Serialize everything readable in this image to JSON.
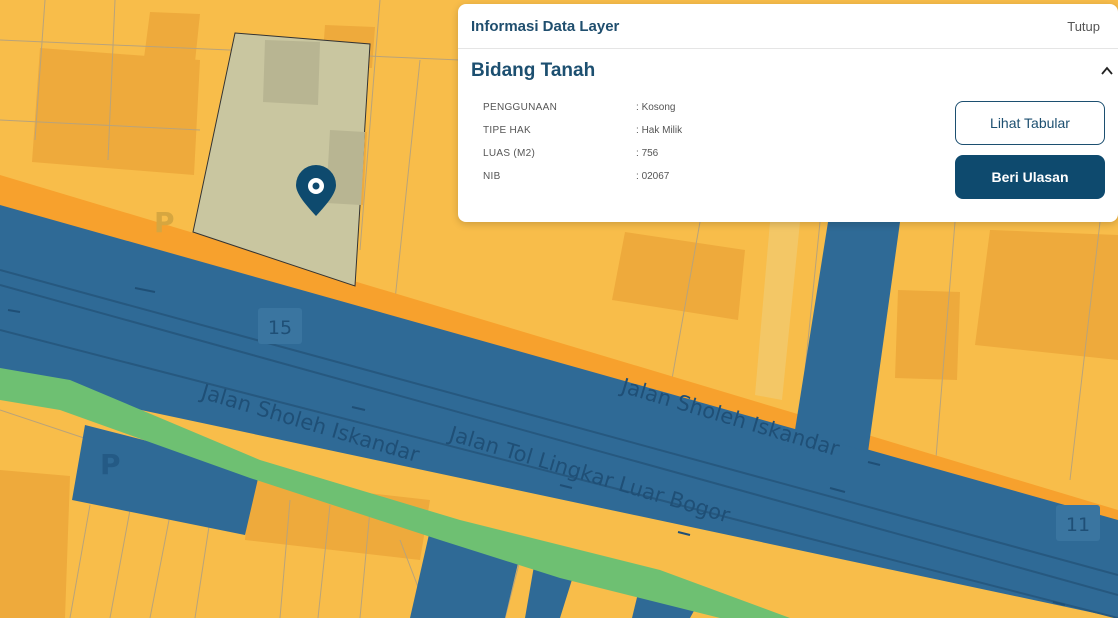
{
  "panel": {
    "title": "Informasi Data Layer",
    "close_label": "Tutup",
    "section_title": "Bidang Tanah",
    "attributes": [
      {
        "label": "PENGGUNAAN",
        "value": "Kosong"
      },
      {
        "label": "TIPE HAK",
        "value": "Hak Milik"
      },
      {
        "label": "LUAS (M2)",
        "value": "756"
      },
      {
        "label": "NIB",
        "value": "02067"
      }
    ],
    "tabular_button": "Lihat Tabular",
    "review_button": "Beri Ulasan"
  },
  "map": {
    "road_labels": [
      "Jalan Sholeh Iskandar",
      "Jalan Sholeh Iskandar",
      "Jalan Tol Lingkar Luar Bogor"
    ],
    "route_numbers": [
      "15",
      "11"
    ],
    "parking_symbol": "P",
    "colors": {
      "parcel": "#f8bd4a",
      "building": "#eeaa3c",
      "road_orange": "#f7a12d",
      "toll_road": "#2f6a96",
      "green_strip": "#6ec072",
      "selected_parcel": "#c9c6a0",
      "marker": "#0e4a6e"
    }
  }
}
